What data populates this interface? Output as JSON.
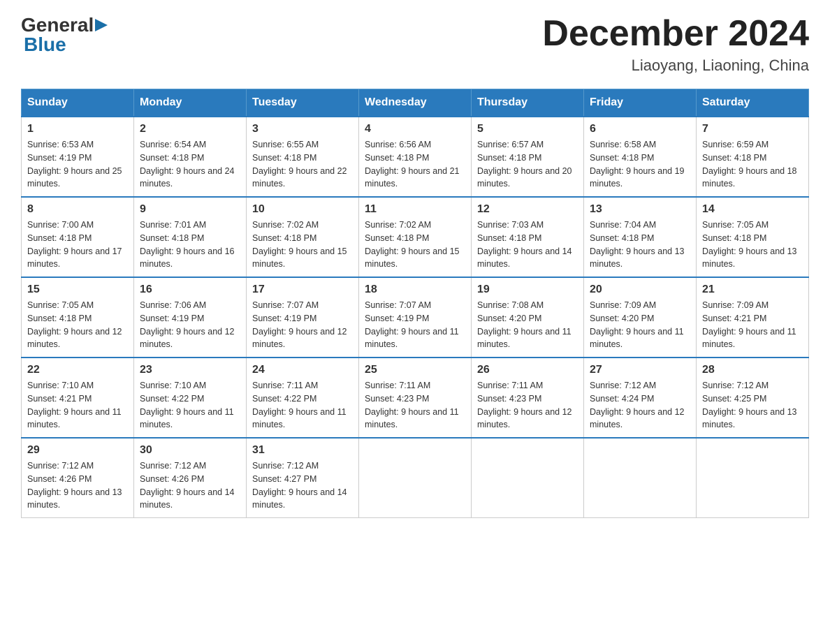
{
  "logo": {
    "general": "General",
    "arrow": "▶",
    "blue": "Blue"
  },
  "title": "December 2024",
  "subtitle": "Liaoyang, Liaoning, China",
  "weekdays": [
    "Sunday",
    "Monday",
    "Tuesday",
    "Wednesday",
    "Thursday",
    "Friday",
    "Saturday"
  ],
  "weeks": [
    [
      {
        "day": "1",
        "sunrise": "6:53 AM",
        "sunset": "4:19 PM",
        "daylight": "9 hours and 25 minutes."
      },
      {
        "day": "2",
        "sunrise": "6:54 AM",
        "sunset": "4:18 PM",
        "daylight": "9 hours and 24 minutes."
      },
      {
        "day": "3",
        "sunrise": "6:55 AM",
        "sunset": "4:18 PM",
        "daylight": "9 hours and 22 minutes."
      },
      {
        "day": "4",
        "sunrise": "6:56 AM",
        "sunset": "4:18 PM",
        "daylight": "9 hours and 21 minutes."
      },
      {
        "day": "5",
        "sunrise": "6:57 AM",
        "sunset": "4:18 PM",
        "daylight": "9 hours and 20 minutes."
      },
      {
        "day": "6",
        "sunrise": "6:58 AM",
        "sunset": "4:18 PM",
        "daylight": "9 hours and 19 minutes."
      },
      {
        "day": "7",
        "sunrise": "6:59 AM",
        "sunset": "4:18 PM",
        "daylight": "9 hours and 18 minutes."
      }
    ],
    [
      {
        "day": "8",
        "sunrise": "7:00 AM",
        "sunset": "4:18 PM",
        "daylight": "9 hours and 17 minutes."
      },
      {
        "day": "9",
        "sunrise": "7:01 AM",
        "sunset": "4:18 PM",
        "daylight": "9 hours and 16 minutes."
      },
      {
        "day": "10",
        "sunrise": "7:02 AM",
        "sunset": "4:18 PM",
        "daylight": "9 hours and 15 minutes."
      },
      {
        "day": "11",
        "sunrise": "7:02 AM",
        "sunset": "4:18 PM",
        "daylight": "9 hours and 15 minutes."
      },
      {
        "day": "12",
        "sunrise": "7:03 AM",
        "sunset": "4:18 PM",
        "daylight": "9 hours and 14 minutes."
      },
      {
        "day": "13",
        "sunrise": "7:04 AM",
        "sunset": "4:18 PM",
        "daylight": "9 hours and 13 minutes."
      },
      {
        "day": "14",
        "sunrise": "7:05 AM",
        "sunset": "4:18 PM",
        "daylight": "9 hours and 13 minutes."
      }
    ],
    [
      {
        "day": "15",
        "sunrise": "7:05 AM",
        "sunset": "4:18 PM",
        "daylight": "9 hours and 12 minutes."
      },
      {
        "day": "16",
        "sunrise": "7:06 AM",
        "sunset": "4:19 PM",
        "daylight": "9 hours and 12 minutes."
      },
      {
        "day": "17",
        "sunrise": "7:07 AM",
        "sunset": "4:19 PM",
        "daylight": "9 hours and 12 minutes."
      },
      {
        "day": "18",
        "sunrise": "7:07 AM",
        "sunset": "4:19 PM",
        "daylight": "9 hours and 11 minutes."
      },
      {
        "day": "19",
        "sunrise": "7:08 AM",
        "sunset": "4:20 PM",
        "daylight": "9 hours and 11 minutes."
      },
      {
        "day": "20",
        "sunrise": "7:09 AM",
        "sunset": "4:20 PM",
        "daylight": "9 hours and 11 minutes."
      },
      {
        "day": "21",
        "sunrise": "7:09 AM",
        "sunset": "4:21 PM",
        "daylight": "9 hours and 11 minutes."
      }
    ],
    [
      {
        "day": "22",
        "sunrise": "7:10 AM",
        "sunset": "4:21 PM",
        "daylight": "9 hours and 11 minutes."
      },
      {
        "day": "23",
        "sunrise": "7:10 AM",
        "sunset": "4:22 PM",
        "daylight": "9 hours and 11 minutes."
      },
      {
        "day": "24",
        "sunrise": "7:11 AM",
        "sunset": "4:22 PM",
        "daylight": "9 hours and 11 minutes."
      },
      {
        "day": "25",
        "sunrise": "7:11 AM",
        "sunset": "4:23 PM",
        "daylight": "9 hours and 11 minutes."
      },
      {
        "day": "26",
        "sunrise": "7:11 AM",
        "sunset": "4:23 PM",
        "daylight": "9 hours and 12 minutes."
      },
      {
        "day": "27",
        "sunrise": "7:12 AM",
        "sunset": "4:24 PM",
        "daylight": "9 hours and 12 minutes."
      },
      {
        "day": "28",
        "sunrise": "7:12 AM",
        "sunset": "4:25 PM",
        "daylight": "9 hours and 13 minutes."
      }
    ],
    [
      {
        "day": "29",
        "sunrise": "7:12 AM",
        "sunset": "4:26 PM",
        "daylight": "9 hours and 13 minutes."
      },
      {
        "day": "30",
        "sunrise": "7:12 AM",
        "sunset": "4:26 PM",
        "daylight": "9 hours and 14 minutes."
      },
      {
        "day": "31",
        "sunrise": "7:12 AM",
        "sunset": "4:27 PM",
        "daylight": "9 hours and 14 minutes."
      },
      null,
      null,
      null,
      null
    ]
  ],
  "labels": {
    "sunrise": "Sunrise:",
    "sunset": "Sunset:",
    "daylight": "Daylight:"
  }
}
